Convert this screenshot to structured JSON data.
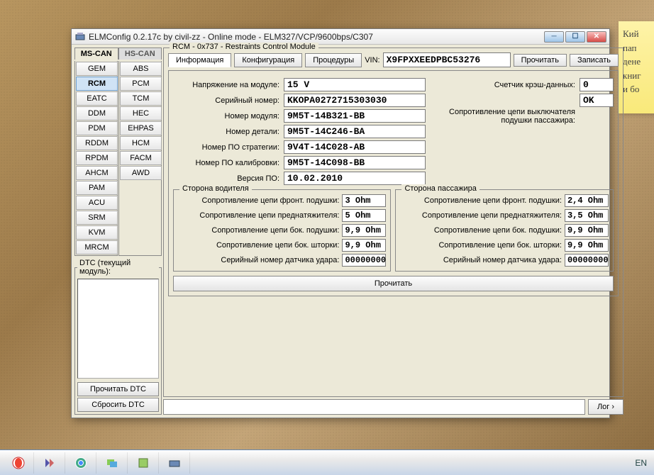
{
  "sticky": {
    "l1": "Кий",
    "l2": "пап",
    "l3": "дене",
    "l4": "книг",
    "l5": "и бо"
  },
  "window": {
    "title": "ELMConfig 0.2.17c by civil-zz - Online mode - ELM327/VCP/9600bps/C307"
  },
  "can_tabs": {
    "ms": "MS-CAN",
    "hs": "HS-CAN"
  },
  "modules_left": [
    "GEM",
    "RCM",
    "EATC",
    "DDM",
    "PDM",
    "RDDM",
    "RPDM",
    "AHCM",
    "PAM",
    "ACU",
    "SRM",
    "KVM",
    "MRCM"
  ],
  "modules_right": [
    "ABS",
    "PCM",
    "TCM",
    "HEC",
    "EHPAS",
    "HCM",
    "FACM",
    "AWD"
  ],
  "selected_module": "RCM",
  "dtc": {
    "legend": "DTC (текущий модуль):",
    "read": "Прочитать DTC",
    "reset": "Сбросить DTC"
  },
  "rcm": {
    "legend": "RCM - 0x737 - Restraints Control Module",
    "tabs": {
      "info": "Информация",
      "config": "Конфигурация",
      "proc": "Процедуры"
    },
    "vin_label": "VIN:",
    "vin": "X9FPXXEEDPBC53276",
    "read": "Прочитать",
    "write": "Записать",
    "labels": {
      "voltage": "Напряжение на модуле:",
      "serial": "Серийный номер:",
      "modnum": "Номер модуля:",
      "partnum": "Номер детали:",
      "stratnum": "Номер ПО стратегии:",
      "calnum": "Номер ПО калибровки:",
      "swver": "Версия ПО:",
      "crash": "Счетчик крэш-данных:",
      "airbag_res": "Сопротивление цепи выключателя подушки пассажира:"
    },
    "values": {
      "voltage": "15 V",
      "serial": "KKOPA0272715303030",
      "modnum": "9M5T-14B321-BB",
      "partnum": "9M5T-14C246-BA",
      "stratnum": "9V4T-14C028-AB",
      "calnum": "9M5T-14C098-BB",
      "swver": "10.02.2010",
      "crash": "0",
      "airbag_res": "OK"
    },
    "driver": {
      "legend": "Сторона водителя",
      "front": "Сопротивление цепи фронт. подушки:",
      "front_v": "3 Ohm",
      "pret": "Сопротивление цепи преднатяжителя:",
      "pret_v": "5 Ohm",
      "side": "Сопротивление цепи бок. подушки:",
      "side_v": "9,9 Ohm",
      "curt": "Сопротивление цепи бок. шторки:",
      "curt_v": "9,9 Ohm",
      "sens": "Серийный номер датчика удара:",
      "sens_v": "00000000"
    },
    "passenger": {
      "legend": "Сторона пассажира",
      "front": "Сопротивление цепи фронт. подушки:",
      "front_v": "2,4 Ohm",
      "pret": "Сопротивление цепи преднатяжителя:",
      "pret_v": "3,5 Ohm",
      "side": "Сопротивление цепи бок. подушки:",
      "side_v": "9,9 Ohm",
      "curt": "Сопротивление цепи бок. шторки:",
      "curt_v": "9,9 Ohm",
      "sens": "Серийный номер датчика удара:",
      "sens_v": "00000000"
    },
    "read_all": "Прочитать"
  },
  "log": {
    "label": "Лог",
    "arrow": "›"
  },
  "taskbar": {
    "lang": "EN"
  }
}
